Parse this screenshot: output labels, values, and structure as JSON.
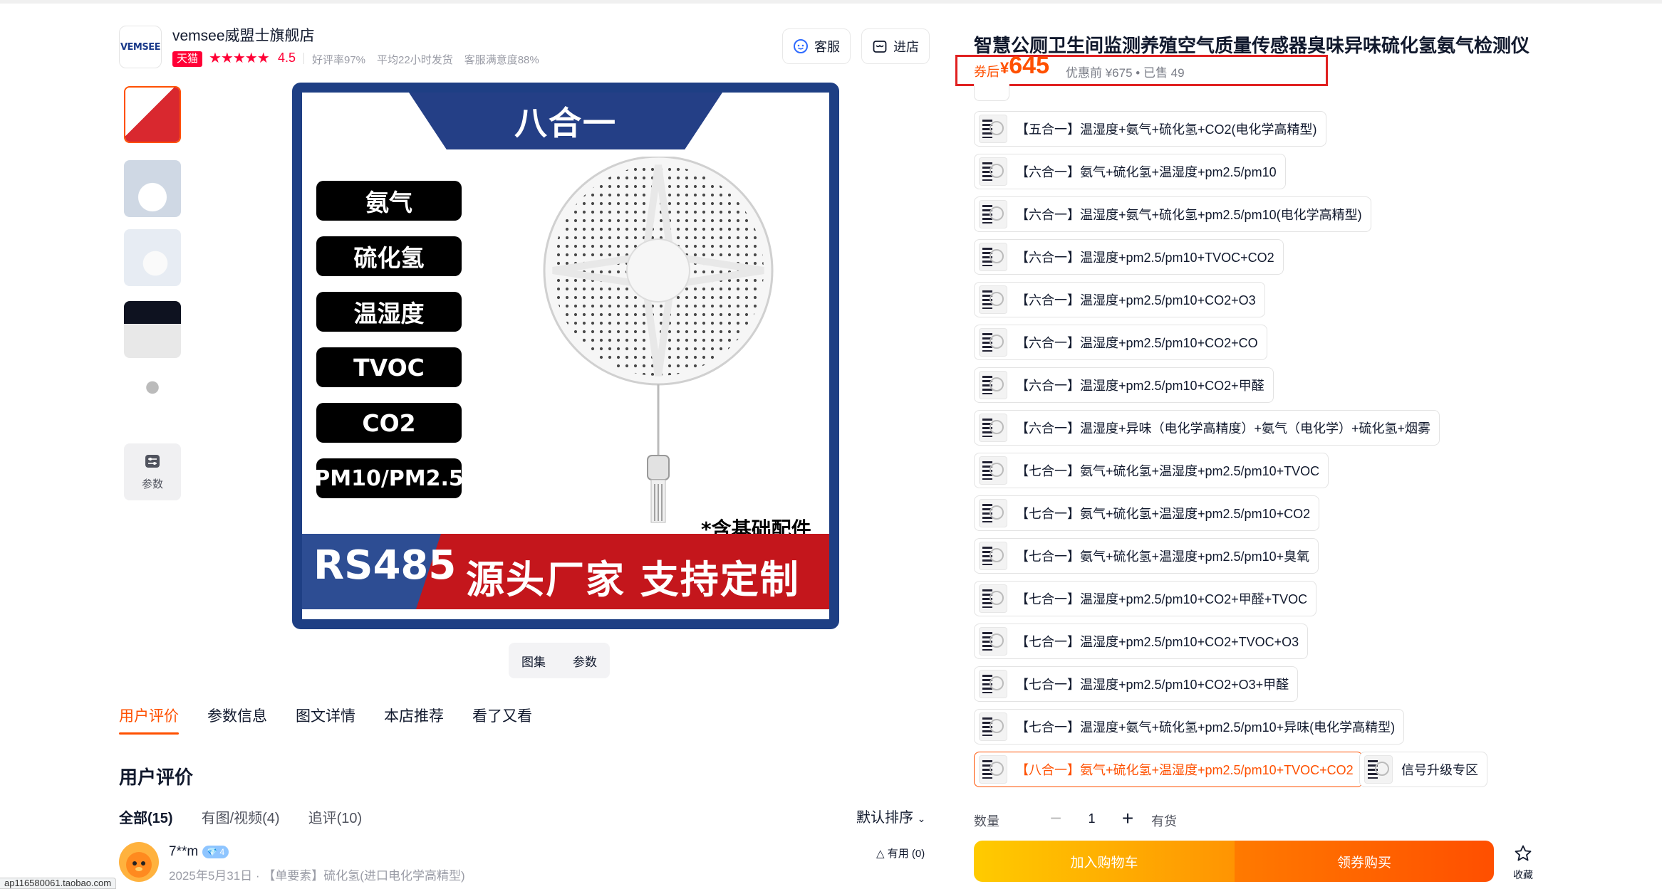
{
  "shop": {
    "logo_text": "VEMSEE",
    "name": "vemsee威盟士旗舰店",
    "badge": "天猫",
    "stars": "★★★★★",
    "rating": "4.5",
    "stat_positive": "好评率97%",
    "stat_ship": "平均22小时发货",
    "stat_service": "客服满意度88%",
    "service_btn": "客服",
    "enter_btn": "进店"
  },
  "gallery": {
    "params_label": "参数",
    "main": {
      "banner": "八合一",
      "pills": [
        "氨气",
        "硫化氢",
        "温湿度",
        "TVOC",
        "CO2",
        "PM10/PM2.5"
      ],
      "note": "*含基础配件",
      "rs485": "RS485",
      "slogan": "源头厂家  支持定制"
    },
    "seg_album": "图集",
    "seg_params": "参数"
  },
  "tabs": [
    "用户评价",
    "参数信息",
    "图文详情",
    "本店推荐",
    "看了又看"
  ],
  "reviews": {
    "title": "用户评价",
    "filter_all": "全部(15)",
    "filter_media": "有图/视频(4)",
    "filter_follow": "追评(10)",
    "sort": "默认排序",
    "user": "7**m",
    "vip_level": "4",
    "meta": "2025年5月31日 · 【单要素】硫化氢(进口电化学高精型)",
    "useful": "有用 (0)"
  },
  "status_url": "ap116580061.taobao.com",
  "product": {
    "title": "智慧公厕卫生间监测养殖空气质量传感器臭味异味硫化氢氨气检测仪",
    "after_label": "券后",
    "currency": "¥",
    "price": "645",
    "before": "优惠前 ¥675 • 已售 49",
    "skus": [
      "【五合一】温湿度+氨气+硫化氢+CO2(电化学高精型)",
      "【六合一】氨气+硫化氢+温湿度+pm2.5/pm10",
      "【六合一】温湿度+氨气+硫化氢+pm2.5/pm10(电化学高精型)",
      "【六合一】温湿度+pm2.5/pm10+TVOC+CO2",
      "【六合一】温湿度+pm2.5/pm10+CO2+O3",
      "【六合一】温湿度+pm2.5/pm10+CO2+CO",
      "【六合一】温湿度+pm2.5/pm10+CO2+甲醛",
      "【六合一】温湿度+异味（电化学高精度）+氨气（电化学）+硫化氢+烟雾",
      "【七合一】氨气+硫化氢+温湿度+pm2.5/pm10+TVOC",
      "【七合一】氨气+硫化氢+温湿度+pm2.5/pm10+CO2",
      "【七合一】氨气+硫化氢+温湿度+pm2.5/pm10+臭氧",
      "【七合一】温湿度+pm2.5/pm10+CO2+甲醛+TVOC",
      "【七合一】温湿度+pm2.5/pm10+CO2+TVOC+O3",
      "【七合一】温湿度+pm2.5/pm10+CO2+O3+甲醛",
      "【七合一】温湿度+氨气+硫化氢+pm2.5/pm10+异味(电化学高精型)",
      "【八合一】氨气+硫化氢+温湿度+pm2.5/pm10+TVOC+CO2",
      "信号升级专区"
    ],
    "qty_label": "数量",
    "qty_value": "1",
    "stock": "有货",
    "cart_btn": "加入购物车",
    "buy_btn": "领券购买",
    "fav": "收藏"
  },
  "colors": {
    "accent": "#ff5000",
    "tmall_red": "#ff0036",
    "price_box": "#e02020",
    "main_blue": "#1e3f84"
  }
}
